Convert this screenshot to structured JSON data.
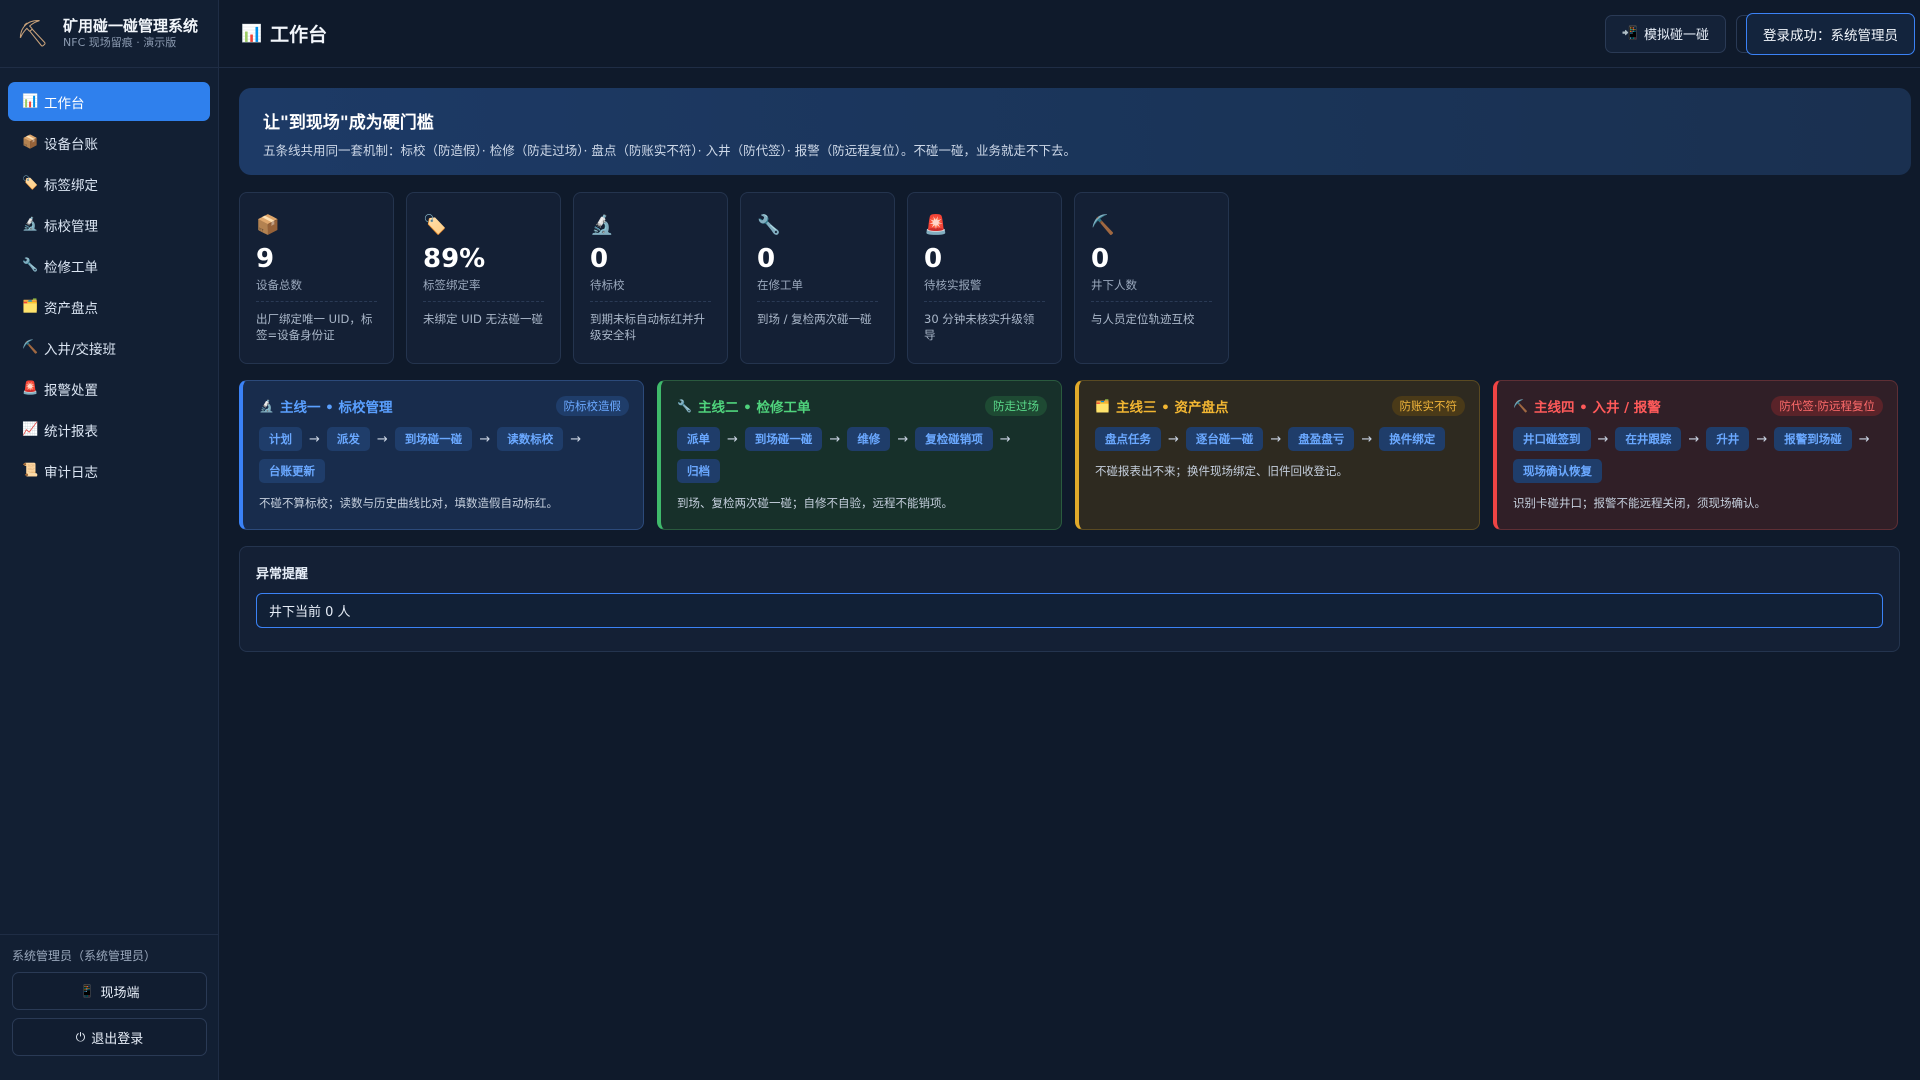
{
  "brand": {
    "title": "矿用碰一碰管理系统",
    "subtitle": "NFC 现场留痕 · 演示版",
    "icon": "pickaxe-icon"
  },
  "sidebar": {
    "items": [
      {
        "icon": "📊",
        "label": "工作台",
        "active": true
      },
      {
        "icon": "📦",
        "label": "设备台账"
      },
      {
        "icon": "🏷️",
        "label": "标签绑定"
      },
      {
        "icon": "🔬",
        "label": "标校管理"
      },
      {
        "icon": "🔧",
        "label": "检修工单"
      },
      {
        "icon": "🗂️",
        "label": "资产盘点"
      },
      {
        "icon": "⛏️",
        "label": "入井/交接班"
      },
      {
        "icon": "🚨",
        "label": "报警处置"
      },
      {
        "icon": "📈",
        "label": "统计报表"
      },
      {
        "icon": "📜",
        "label": "审计日志"
      }
    ],
    "user": "系统管理员（系统管理员）",
    "field_button": "现场端",
    "field_icon": "📱",
    "logout_button": "退出登录",
    "logout_icon": "⏻"
  },
  "header": {
    "title": "工作台",
    "title_icon": "📊",
    "simulate_button": "模拟碰一碰",
    "simulate_icon": "📲",
    "login_toast": "登录成功：系统管理员"
  },
  "banner": {
    "title": "让\"到现场\"成为硬门槛",
    "desc": "五条线共用同一套机制：标校（防造假）· 检修（防走过场）· 盘点（防账实不符）· 入井（防代签）· 报警（防远程复位）。不碰一碰，业务就走不下去。"
  },
  "stats": [
    {
      "icon": "📦",
      "value": "9",
      "label": "设备总数",
      "note": "出厂绑定唯一 UID，标签=设备身份证"
    },
    {
      "icon": "🏷️",
      "value": "89%",
      "label": "标签绑定率",
      "note": "未绑定 UID 无法碰一碰"
    },
    {
      "icon": "🔬",
      "value": "0",
      "label": "待标校",
      "note": "到期未标自动标红并升级安全科"
    },
    {
      "icon": "🔧",
      "value": "0",
      "label": "在修工单",
      "note": "到场 / 复检两次碰一碰"
    },
    {
      "icon": "🚨",
      "value": "0",
      "label": "待核实报警",
      "note": "30 分钟未核实升级领导"
    },
    {
      "icon": "⛏️",
      "value": "0",
      "label": "井下人数",
      "note": "与人员定位轨迹互校"
    }
  ],
  "lines": [
    {
      "icon": "🔬",
      "title": "主线一 • 标校管理",
      "tag": "防标校造假",
      "steps": [
        "计划",
        "派发",
        "到场碰一碰",
        "读数标校",
        "台账更新"
      ],
      "note": "不碰不算标校；读数与历史曲线比对，填数造假自动标红。"
    },
    {
      "icon": "🔧",
      "title": "主线二 • 检修工单",
      "tag": "防走过场",
      "steps": [
        "派单",
        "到场碰一碰",
        "维修",
        "复检碰销项",
        "归档"
      ],
      "note": "到场、复检两次碰一碰；自修不自验，远程不能销项。"
    },
    {
      "icon": "🗂️",
      "title": "主线三 • 资产盘点",
      "tag": "防账实不符",
      "steps": [
        "盘点任务",
        "逐台碰一碰",
        "盘盈盘亏",
        "换件绑定"
      ],
      "note": "不碰报表出不来；换件现场绑定、旧件回收登记。"
    },
    {
      "icon": "⛏️",
      "title": "主线四 • 入井 / 报警",
      "tag": "防代签·防远程复位",
      "steps": [
        "井口碰签到",
        "在井跟踪",
        "升井",
        "报警到场碰",
        "现场确认恢复"
      ],
      "note": "识别卡碰井口；报警不能远程关闭，须现场确认。"
    }
  ],
  "alerts": {
    "title": "异常提醒",
    "items": [
      "井下当前 0 人"
    ]
  }
}
